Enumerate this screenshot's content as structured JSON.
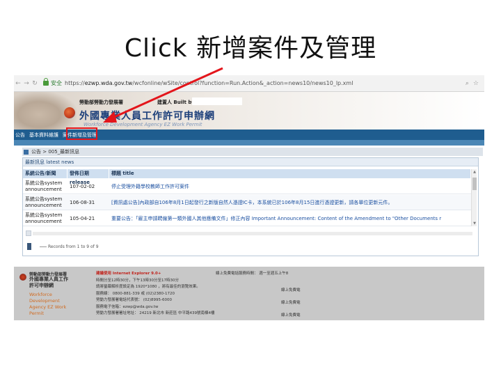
{
  "slide": {
    "title": "Click 新增案件及管理"
  },
  "browser": {
    "secure_label": "安全",
    "url_prefix": "https://",
    "url_host": "ezwp.wda.gov.tw",
    "url_path": "/wcfonline/wSite/control?function=Run.Action&_action=news10/news10_lp.xml"
  },
  "banner": {
    "dept": "勞動部勞動力發展署",
    "builder_label": "建置人 Built by:",
    "system_name": "外國專業人員工作許可申辦網",
    "system_name_en": "Workforce Development Agency EZ Work Permit"
  },
  "nav": {
    "items": [
      {
        "label": "公告"
      },
      {
        "label": "基本資料維護"
      },
      {
        "label": "案件新增及管理"
      }
    ]
  },
  "breadcrumb": "公告 > 005_最新訊息",
  "panel": {
    "title": "最新訊息 latest news",
    "columns": [
      "系統公告/新聞",
      "發佈日期 release",
      "標題 title"
    ],
    "rows": [
      {
        "type": "系統公告system announcement",
        "date": "107-02-02",
        "title": "停止受理外籍學校教師工作許可案件"
      },
      {
        "type": "系統公告system announcement",
        "date": "106-08-31",
        "title": "[資訊處公告]內政部自106年8月1日起發行之新版自然人憑證IC卡，本系統已於106年8月15日進行憑證更新，請各單位更新元件。"
      },
      {
        "type": "系統公告system announcement",
        "date": "105-04-21",
        "title": "重要公告：「雇主申請聘僱第一類外國人其他應備文件」修正內容 Important Announcement: Content of the Amendment to \"Other Documents r"
      }
    ],
    "records": "Records from 1 to 9 of 9"
  },
  "footer": {
    "dept": "勞動部勞動力發展署",
    "system": "外國專業人員工作許可申辦網",
    "system_en": "Workforce Development Agency EZ Work Permit",
    "col1": [
      "建議使用  Internet Explorer 9.0+",
      "時間分至12時30分，下午13時30分至17時30分",
      "請將螢幕解析度設定為 1920*1080  ，將有最佳的瀏覽效果。",
      "服務線：    0800-881-339    或    (02)2380-1720",
      "勞動力發展署電話代表號：   (02)8995-6000",
      "服務電子信箱：ezwp@wda.gov.tw",
      "勞動力發展署署址地址：    24219 新北市 新莊區 中平路439號南棟4樓"
    ],
    "col2": "線上免費電話服務時間：   週一至週五上午8",
    "col3": [
      "線上免費電",
      "線上免費電",
      "線上免費電"
    ]
  },
  "colors": {
    "nav_bg": "#1f5d8f",
    "annotation": "#e3151b",
    "system_name": "#1c3f7a"
  }
}
